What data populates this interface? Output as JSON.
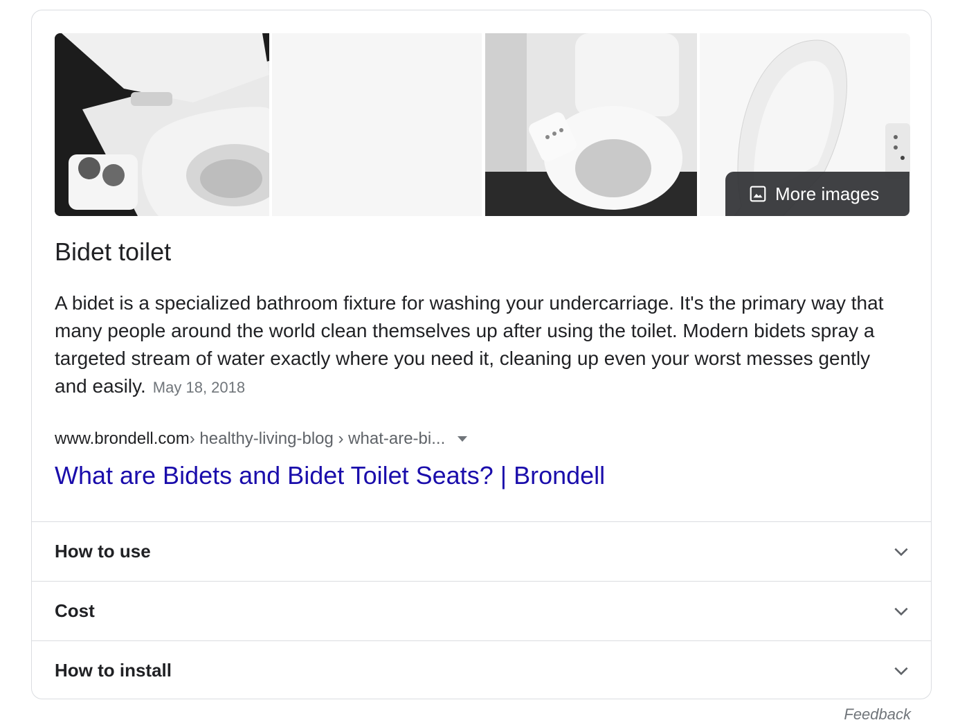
{
  "images": [
    {
      "name": "bidet-attachment-image"
    },
    {
      "name": "placeholder-image"
    },
    {
      "name": "bidet-seat-bathroom-image"
    },
    {
      "name": "bidet-seat-open-lid-image"
    }
  ],
  "more_images": {
    "label": "More images",
    "icon": "image-icon"
  },
  "panel": {
    "title": "Bidet toilet",
    "description": "A bidet is a specialized bathroom fixture for washing your undercarriage. It's the primary way that many people around the world clean themselves up after using the toilet. Modern bidets spray a targeted stream of water exactly where you need it, cleaning up even your worst messes gently and easily.",
    "date": "May 18, 2018"
  },
  "source": {
    "domain": "www.brondell.com",
    "path": " › healthy-living-blog › what-are-bi...",
    "link_text": "What are Bidets and Bidet Toilet Seats? | Brondell"
  },
  "accordion": [
    {
      "label": "How to use",
      "icon": "chevron-down-icon"
    },
    {
      "label": "Cost",
      "icon": "chevron-down-icon"
    },
    {
      "label": "How to install",
      "icon": "chevron-down-icon"
    }
  ],
  "feedback_label": "Feedback",
  "colors": {
    "link": "#1a0dab",
    "border": "#dadce0",
    "overlay": "#303134"
  }
}
